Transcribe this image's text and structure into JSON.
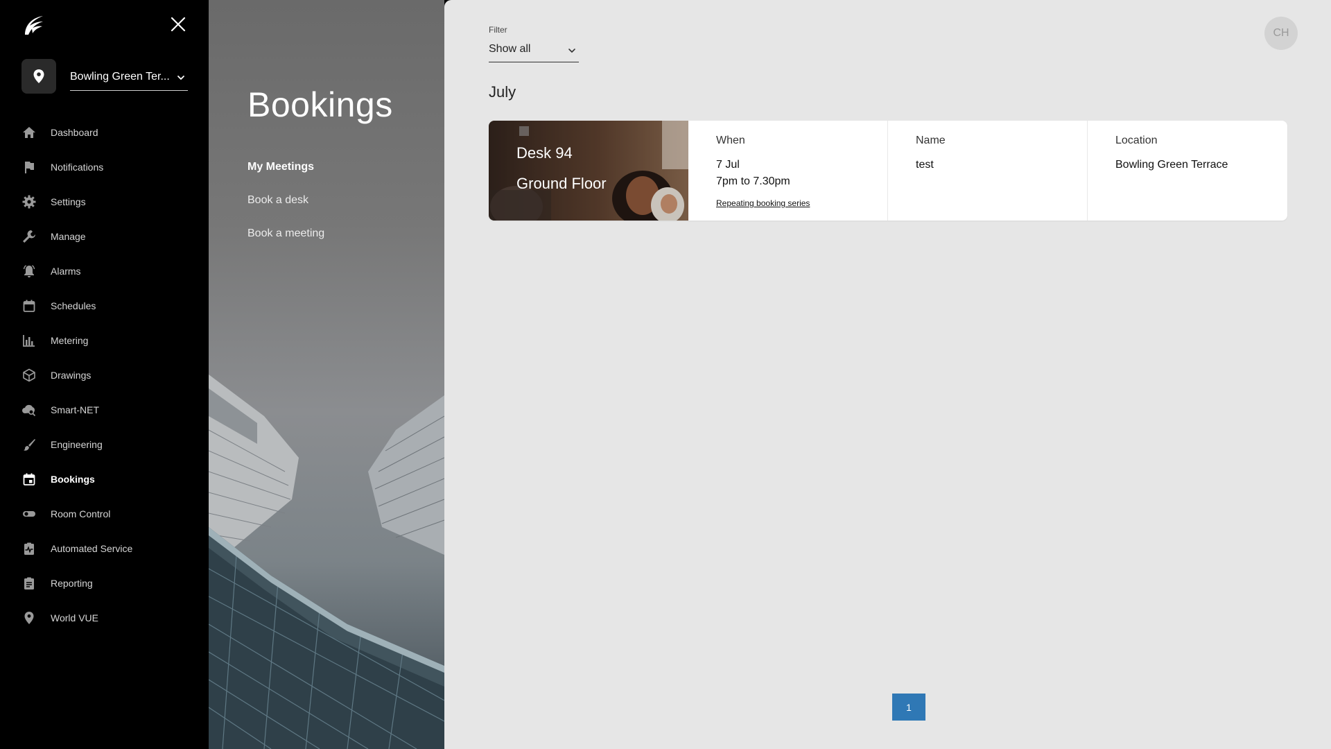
{
  "sidebar": {
    "site": {
      "name": "Bowling Green Ter..."
    },
    "items": [
      {
        "label": "Dashboard",
        "icon": "home-icon"
      },
      {
        "label": "Notifications",
        "icon": "flag-icon"
      },
      {
        "label": "Settings",
        "icon": "gear-icon"
      },
      {
        "label": "Manage",
        "icon": "wrench-icon"
      },
      {
        "label": "Alarms",
        "icon": "bell-icon"
      },
      {
        "label": "Schedules",
        "icon": "calendar-icon"
      },
      {
        "label": "Metering",
        "icon": "bar-chart-icon"
      },
      {
        "label": "Drawings",
        "icon": "cube-icon"
      },
      {
        "label": "Smart-NET",
        "icon": "cloud-search-icon"
      },
      {
        "label": "Engineering",
        "icon": "brush-icon"
      },
      {
        "label": "Bookings",
        "icon": "event-icon",
        "active": true
      },
      {
        "label": "Room Control",
        "icon": "toggle-icon"
      },
      {
        "label": "Automated Service",
        "icon": "clipboard-pulse-icon"
      },
      {
        "label": "Reporting",
        "icon": "report-icon"
      },
      {
        "label": "World VUE",
        "icon": "location-pin-icon"
      }
    ]
  },
  "bookings_panel": {
    "title": "Bookings",
    "sub_nav": [
      {
        "label": "My Meetings",
        "active": true
      },
      {
        "label": "Book a desk"
      },
      {
        "label": "Book a meeting"
      }
    ]
  },
  "main": {
    "avatar": "CH",
    "filter": {
      "label": "Filter",
      "value": "Show all"
    },
    "month": "July",
    "booking": {
      "desk": "Desk 94",
      "floor": "Ground Floor",
      "when_header": "When",
      "date": "7 Jul",
      "time": "7pm to 7.30pm",
      "repeat_link": "Repeating booking series",
      "name_header": "Name",
      "name": "test",
      "location_header": "Location",
      "location": "Bowling Green Terrace"
    },
    "pagination": {
      "current_page": "1"
    }
  },
  "colors": {
    "sidebar_bg": "#000000",
    "main_bg": "#e6e6e6",
    "pager_active": "#2f78b5"
  }
}
